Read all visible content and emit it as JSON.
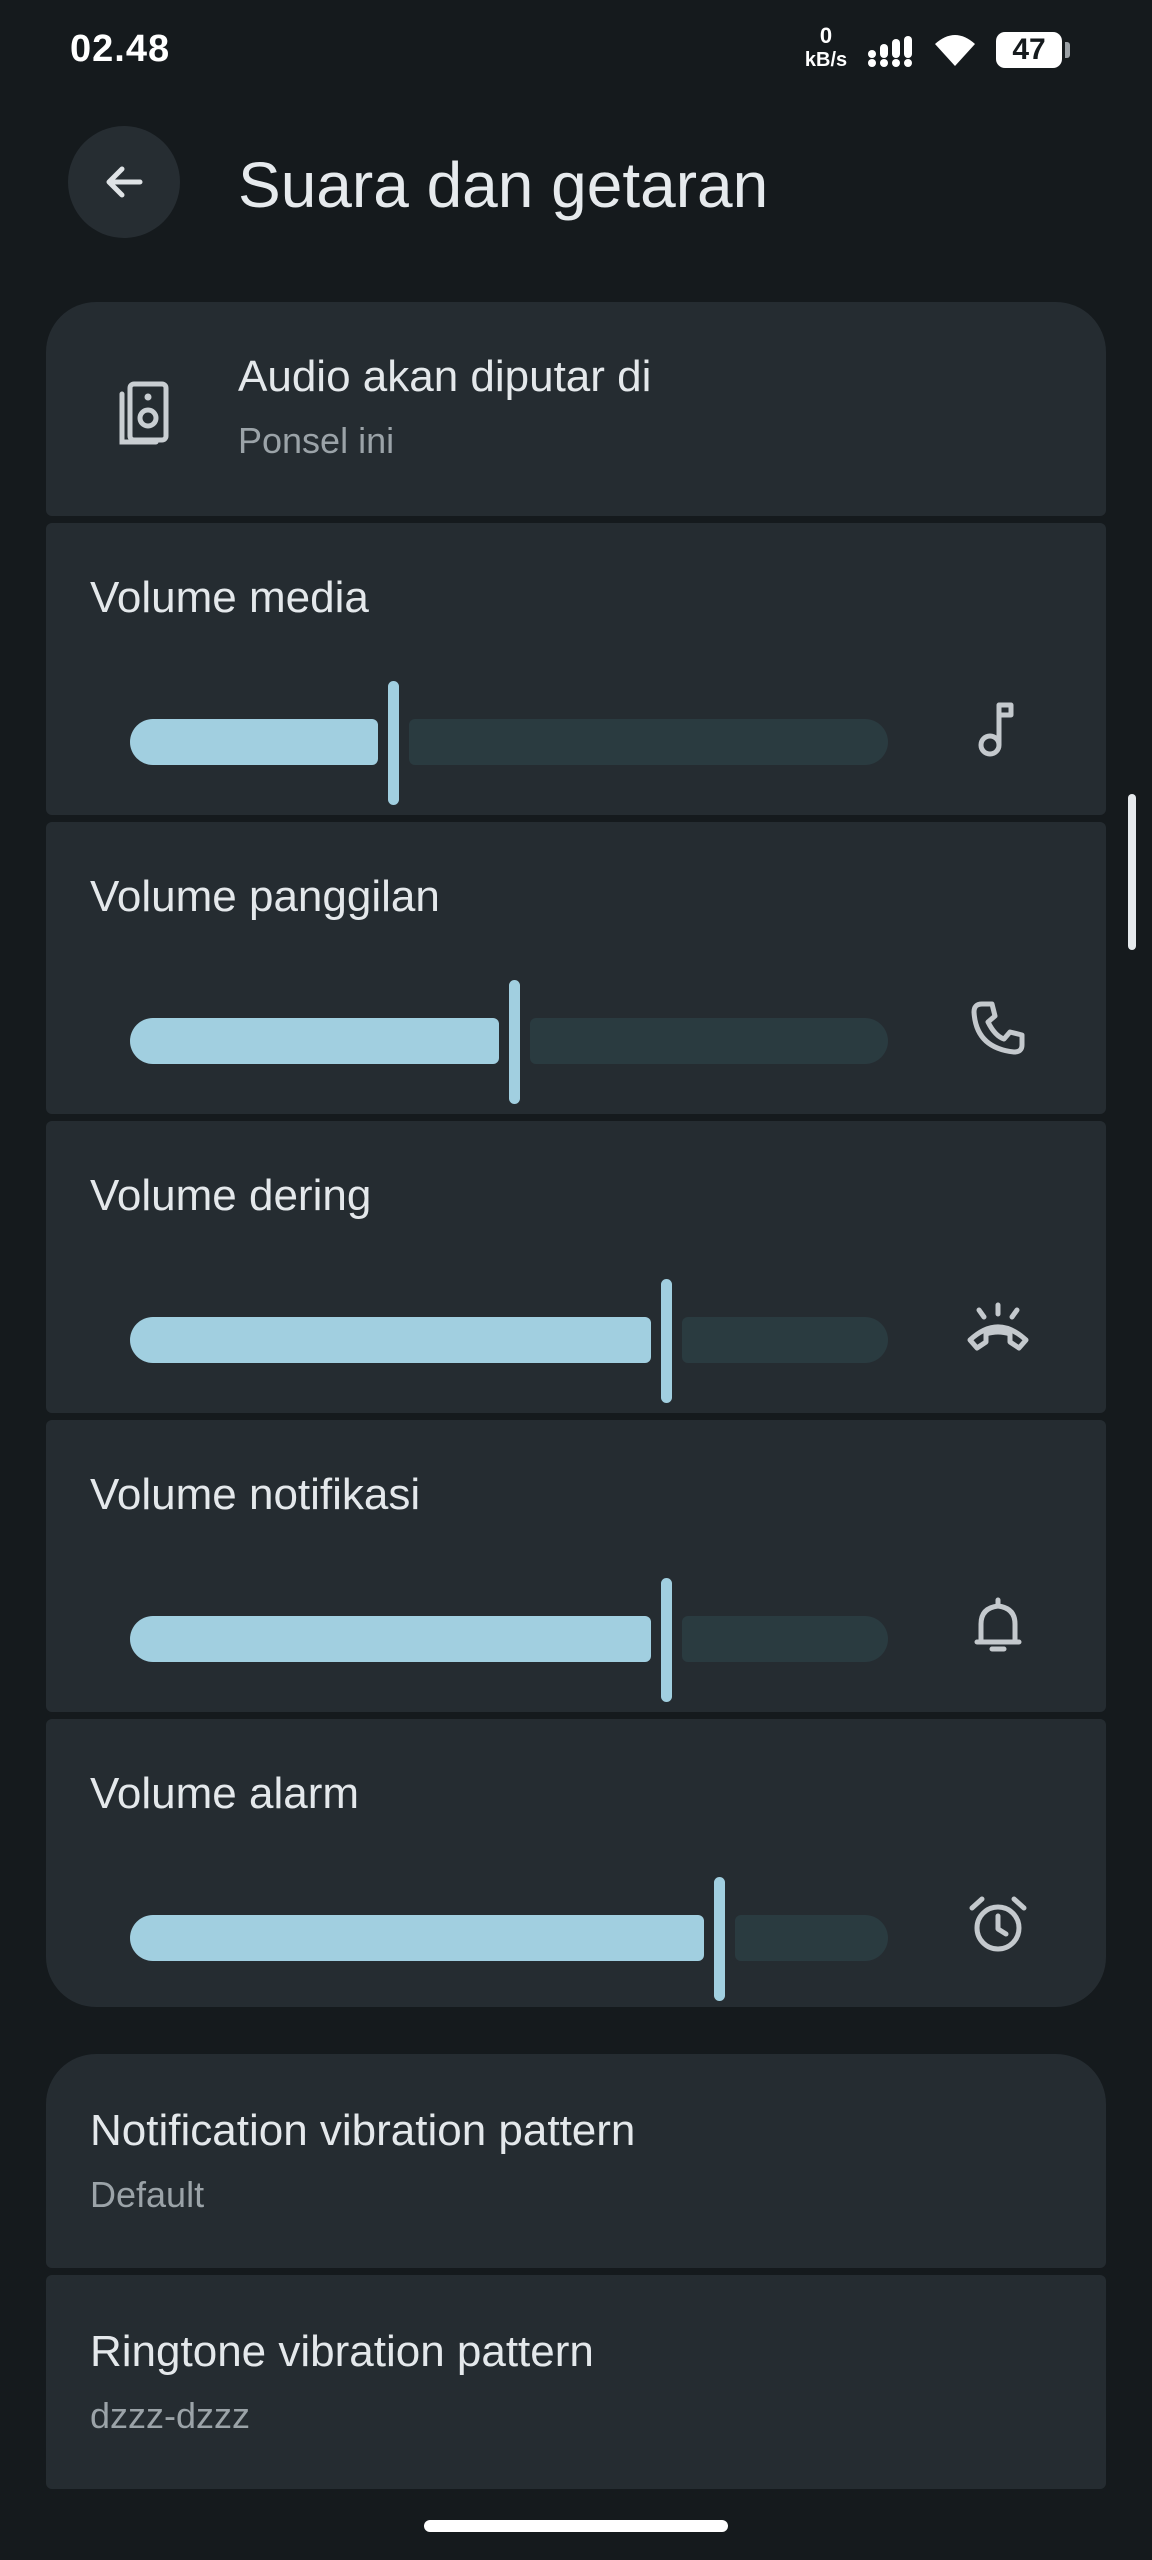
{
  "status_bar": {
    "time": "02.48",
    "net_speed_value": "0",
    "net_speed_unit": "kB/s",
    "battery": "47",
    "icons": [
      "signal-icon",
      "wifi-icon",
      "battery-icon"
    ]
  },
  "header": {
    "title": "Suara dan getaran",
    "back_icon": "arrow-back-icon"
  },
  "audio_output": {
    "title": "Audio akan diputar di",
    "subtitle": "Ponsel ini",
    "icon": "speaker-icon"
  },
  "volumes": [
    {
      "label": "Volume media",
      "level": 0.34,
      "icon": "music-note-icon"
    },
    {
      "label": "Volume panggilan",
      "level": 0.5,
      "icon": "phone-icon"
    },
    {
      "label": "Volume dering",
      "level": 0.7,
      "icon": "ring-volume-icon"
    },
    {
      "label": "Volume notifikasi",
      "level": 0.7,
      "icon": "bell-icon"
    },
    {
      "label": "Volume alarm",
      "level": 0.77,
      "icon": "alarm-icon"
    }
  ],
  "vibration": [
    {
      "title": "Notification vibration pattern",
      "value": "Default"
    },
    {
      "title": "Ringtone vibration pattern",
      "value": "dzzz-dzzz"
    }
  ],
  "colors": {
    "background": "#151a1d",
    "card": "#252c31",
    "slider_active": "#a1cfe0",
    "slider_inactive": "#2a3b40"
  }
}
